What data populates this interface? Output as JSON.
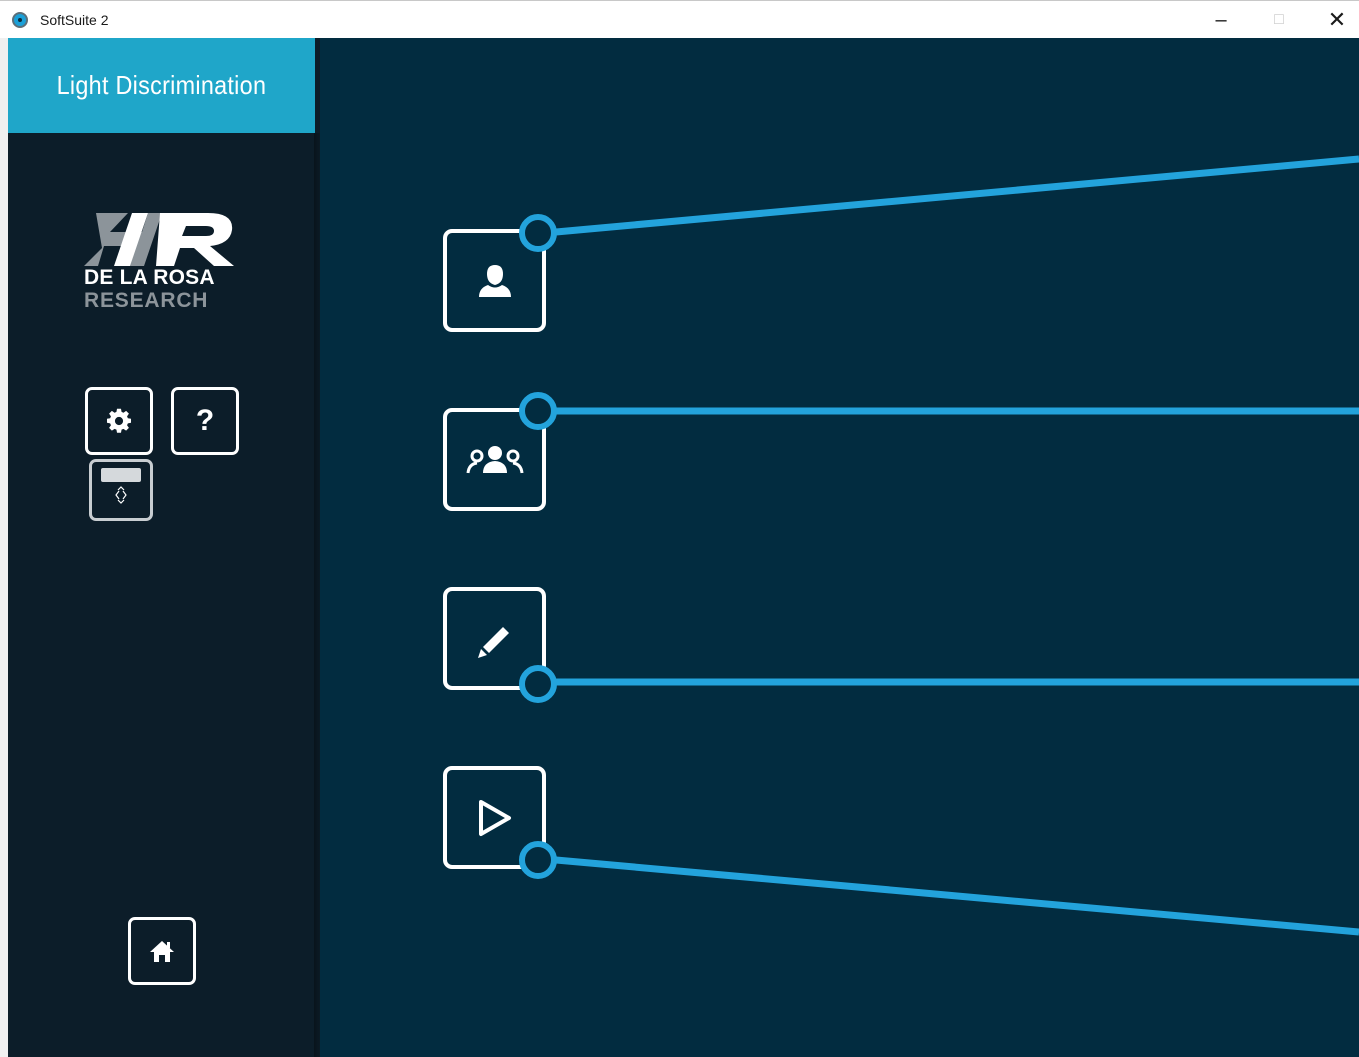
{
  "window": {
    "title": "SoftSuite 2",
    "minimize_glyph": "–",
    "maximize_glyph": "□",
    "close_glyph": "✕"
  },
  "sidebar": {
    "module_title": "Light Discrimination",
    "logo": {
      "line1": "DE LA ROSA",
      "line2": "RESEARCH"
    },
    "buttons": {
      "settings_icon": "gear-icon",
      "help_label": "?",
      "screen_icon": "screen-resize-icon",
      "home_icon": "home-icon"
    }
  },
  "main": {
    "buttons": [
      {
        "icon": "user-icon"
      },
      {
        "icon": "group-icon"
      },
      {
        "icon": "pencil-icon"
      },
      {
        "icon": "play-icon"
      }
    ]
  },
  "colors": {
    "accent": "#1fa6c9",
    "connector": "#23a3dc",
    "sidebar_bg": "#0c1d29",
    "main_bg": "#022c40"
  }
}
